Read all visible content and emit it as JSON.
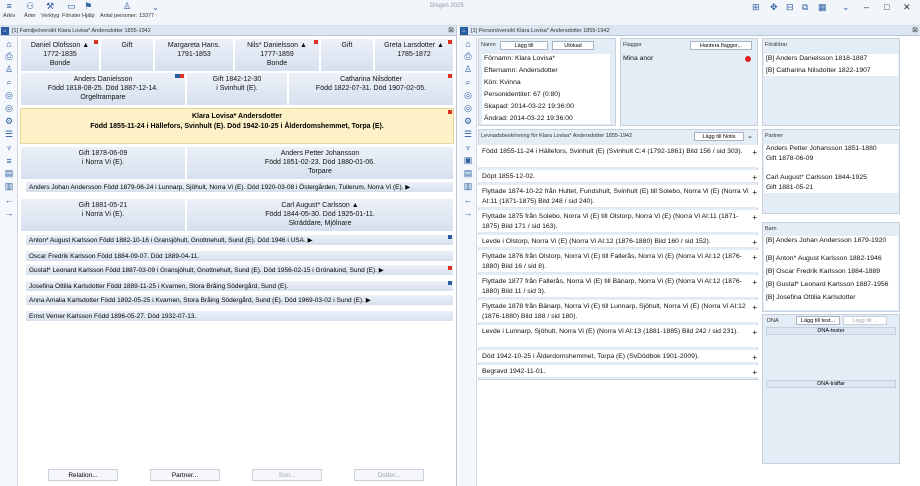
{
  "app": {
    "title": "Disgen 2025",
    "toolbar": [
      {
        "label": "Arkiv",
        "icon": "menu-icon"
      },
      {
        "label": "Ärter",
        "icon": "people-icon"
      },
      {
        "label": "Verktyg",
        "icon": "tools-icon"
      },
      {
        "label": "Fönster",
        "icon": "window-icon"
      },
      {
        "label": "Hjälp",
        "icon": "help-icon"
      },
      {
        "label": "Antal personer: 13377",
        "icon": "person-count-icon"
      }
    ]
  },
  "left": {
    "header": "[1] Familjeöversikt Klara Lovisa* Andersdotter 1855-1942",
    "gp": [
      {
        "name": "Daniel Olofsson ▲",
        "dates": "1772-1835",
        "occ": "Bonde"
      },
      {
        "name": "Gift",
        "dates": "",
        "occ": ""
      },
      {
        "name": "Margareta Hans.",
        "dates": "1791-1853",
        "occ": ""
      },
      {
        "name": "Nils* Danielsson ▲",
        "dates": "1777-1859",
        "occ": "Bonde"
      },
      {
        "name": "Gift",
        "dates": "",
        "occ": ""
      },
      {
        "name": "Greta Larsdotter ▲",
        "dates": "1785-1872",
        "occ": ""
      }
    ],
    "father": {
      "name": "Anders Danielsson",
      "l2": "Född 1818-08-25. Död 1887-12-14.",
      "l3": "Orgeltrampare"
    },
    "pmarr": {
      "name": "Gift 1842-12-30",
      "l2": "i Svinhult (E).",
      "l3": ""
    },
    "mother": {
      "name": "Catharina Nilsdotter",
      "l2": "Född 1822-07-31. Död 1907-02-05.",
      "l3": ""
    },
    "main": {
      "name": "Klara Lovisa* Andersdotter",
      "l2": "Född 1855-11-24 i Hällefors, Svinhult (E). Död 1942-10-25 i Ålderdomshemmet, Torpa (E)."
    },
    "m1": {
      "a": "Gift 1878-06-09",
      "b": "i Norra Vi (E).",
      "p1": "Anders Petter Johansson",
      "p2": "Född 1851-02-23. Död 1880-01-06.",
      "p3": "Torpare"
    },
    "c1": "Anders Johan Andersson Född 1879-06-24 i Lunnarp, Sjöhult, Norra Vi (E). Död 1920-03-08 i Östergården, Tullerum, Norra Vi (E). ▶",
    "m2": {
      "a": "Gift 1881-05-21",
      "b": "i Norra Vi (E).",
      "p1": "Carl August* Carlsson ▲",
      "p2": "Född 1844-05-30. Död 1925-01-11.",
      "p3": "Skräddare, Mjölnare"
    },
    "children": [
      "Anton* August Karlsson Född 1882-10-16 i Gransjöhult, Gnottnehult, Sund (E). Död 1946 i USA. ▶",
      "Oscar Fredrik Karlsson Född 1884-09-07. Död 1889-04-11.",
      "Gustaf* Leonard Karlsson Född 1887-03-09 i Gransjöhult, Gnottnehult, Sund (E). Död 1956-02-15 i Grönalund, Sund (E). ▶",
      "Josefina Ottilia Karlsdotter Född 1889-11-25 i Kvarnen, Stora Bråing Södergård, Sund (E).",
      "Anna Amalia Karlsdotter Född 1892-05-25 i Kvarnen, Stora Bråing Södergård, Sund (E). Död 1969-03-02 i Sund (E). ▶",
      "Ernst Verner Karlsson Född 1896-05-27. Död 1932-07-13."
    ],
    "buttons": [
      "Relation...",
      "Partner...",
      "Son...",
      "Dotter..."
    ]
  },
  "right": {
    "header": "[1] Personöversikt Klara Lovisa* Andersdotter 1855-1942",
    "name_lbl": "Namn",
    "add_btn": "Lägg till",
    "ext_btn": "Utökad",
    "fields": [
      "Förnamn: Klara Lovisa*",
      "Efternamn: Andersdotter",
      "Kön: Kvinna",
      "Personidentitet: 67 (0:80)",
      "Skapad: 2014-03-22 19:36:00",
      "Ändrad: 2014-03-22 19:36:00"
    ],
    "flags_lbl": "Flaggor",
    "flags_btn": "Hantera flaggor...",
    "flags": [
      "Mina anor"
    ],
    "parents_lbl": "Föräldrar",
    "parents": [
      "[B] Anders Danielsson 1818-1887",
      "[B] Catharina Nilsdotter 1822-1907"
    ],
    "bio_lbl": "Levnadsbeskrivning för Klara Lovisa* Andersdotter 1855-1942",
    "note_btn": "Lägg till Notis",
    "events": [
      "Född 1855-11-24 i Hällefors, Svinhult (E) (Svinhult C:4 (1792-1861) Bild 156 / sid 303).",
      "Döpt 1855-12-02.",
      "Flyttade 1874-10-22 från Hultet, Fundshult, Svinhult (E) till Solebo, Norra Vi (E) (Norra Vi AI:11 (1871-1875) Bild 248 / sid 240).",
      "Flyttade 1875 från Solebo, Norra Vi (E) till Olstorp, Norra Vi (E) (Norra Vi AI:11 (1871-1875) Bild 171 / sid 163).",
      "Levde i Olstorp, Norra Vi (E) (Norra Vi AI:12 (1876-1880) Bild 160 / sid 152).",
      "Flyttade 1876 från Olstorp, Norra Vi (E) till Fallerås, Norra Vi (E) (Norra Vi AI:12 (1876-1880) Bild 16 / sid 8).",
      "Flyttade 1877 från Fallerås, Norra Vi (E) till Bänarp, Norra Vi (E) (Norra Vi AI:12 (1876-1880) Bild 11 / sid 3).",
      "Flyttade 1878 från Bänarp, Norra Vi (E) till Lunnarp, Sjöhult, Norra Vi (E) (Norra Vi AI:12 (1876-1880) Bild 188 / sid 180).",
      "Levde i Lunnarp, Sjöhult, Norra Vi (E) (Norra Vi AI:13 (1881-1885) Bild 242 / sid 231).",
      "Död 1942-10-25 i Ålderdomshemmet, Torpa (E) (SvDödbok 1901-2009).",
      "Begravd 1942-11-01."
    ],
    "partner_lbl": "Partner",
    "partners": [
      "Anders Petter Johansson 1851-1880",
      "Gift 1878-06-09",
      "",
      "Carl August* Carlsson 1844-1925",
      "Gift 1881-05-21"
    ],
    "barn_lbl": "Barn",
    "barn": [
      "[B] Anders Johan Andersson 1879-1920",
      "",
      "[B] Anton* August Karlsson 1882-1946",
      "[B] Oscar Fredrik Karlsson 1884-1889",
      "[B] Gustaf* Leonard Karlsson 1887-1956",
      "[B] Josefina Ottilia Karlsdotter"
    ],
    "dna_lbl": "DNA",
    "dna_btn": "Lägg till test...",
    "dna_btn2": "Lägg till ...",
    "dna_tests": "DNA-tester",
    "dna_hits": "DNA-träffar"
  }
}
